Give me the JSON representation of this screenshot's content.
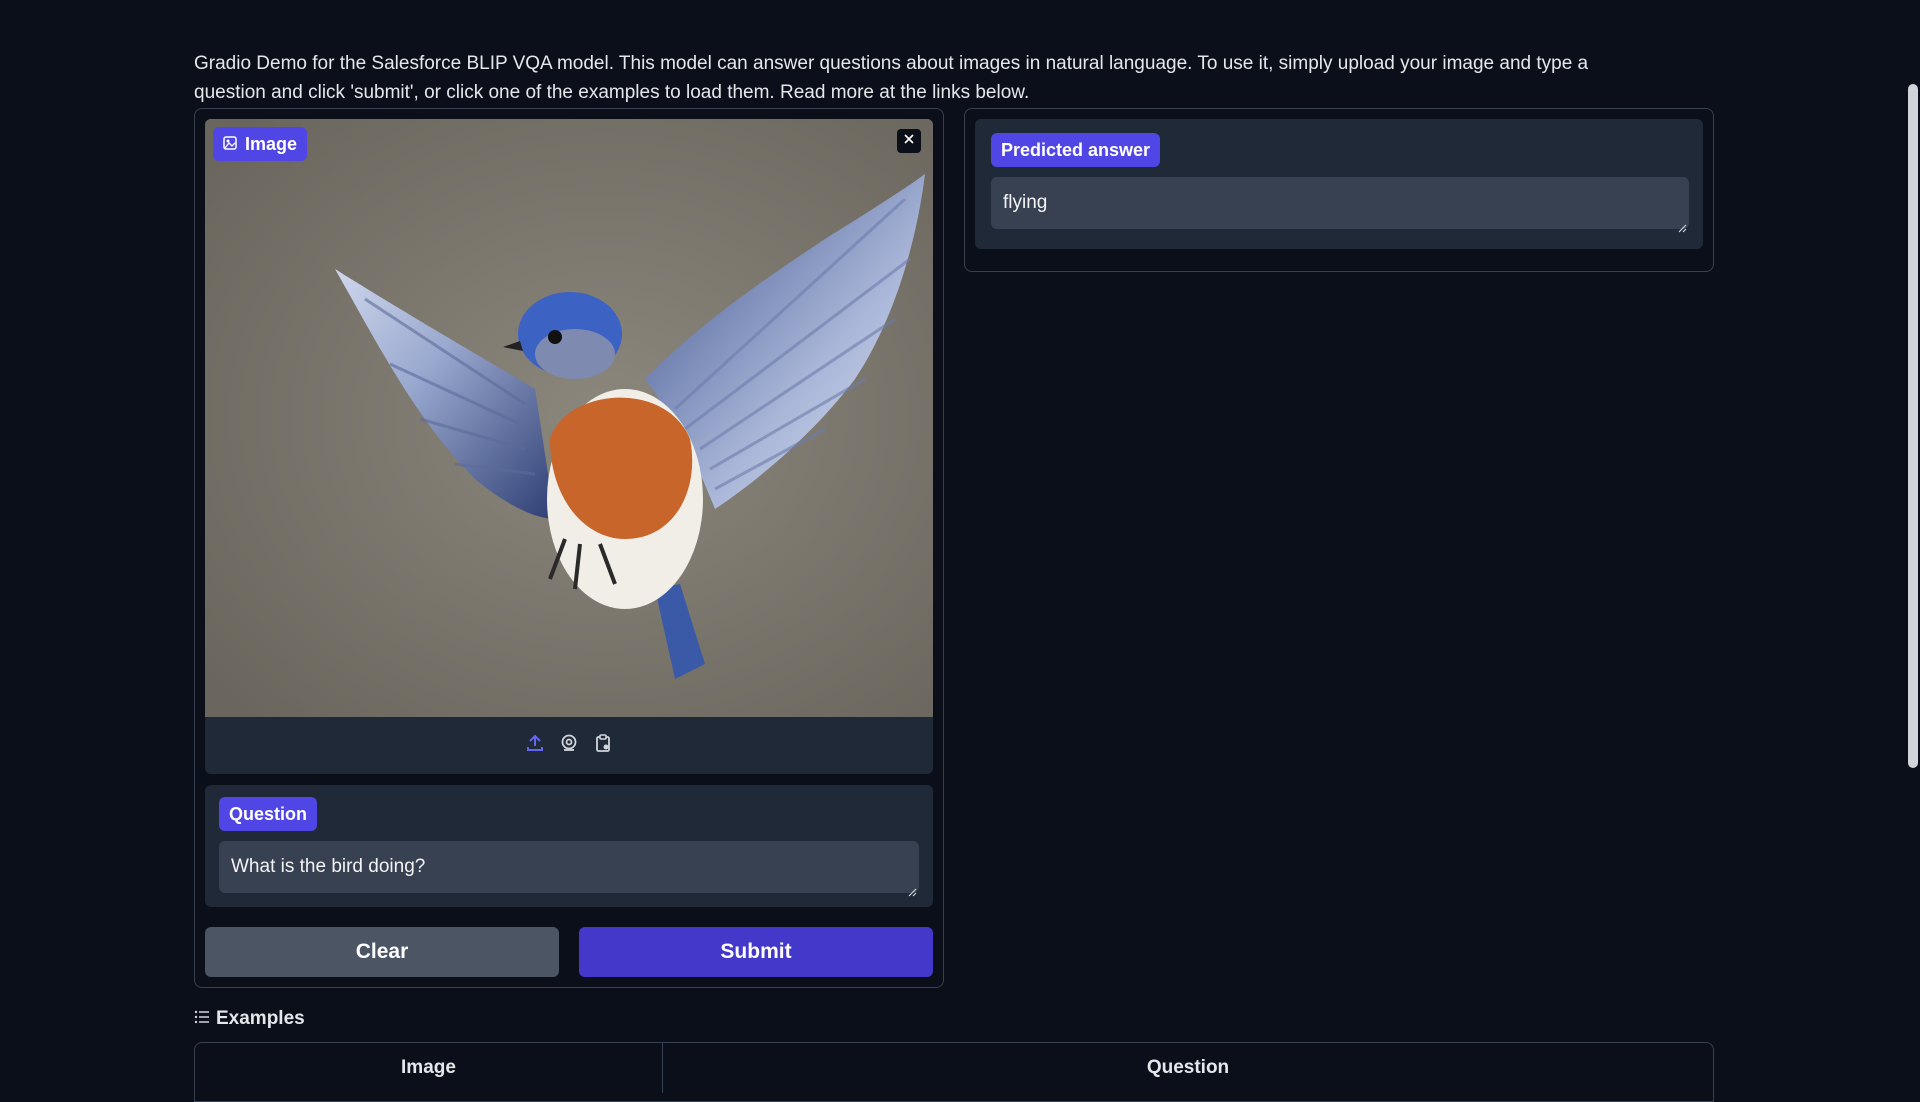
{
  "description": "Gradio Demo for the Salesforce BLIP VQA model. This model can answer questions about images in natural language. To use it, simply upload your image and type a question and click 'submit', or click one of the examples to load them. Read more at the links below.",
  "image_input": {
    "label": "Image",
    "label_icon": "image-icon",
    "close_icon": "close-icon",
    "toolbar": {
      "upload_icon": "upload-icon",
      "webcam_icon": "webcam-icon",
      "clipboard_icon": "clipboard-icon"
    }
  },
  "question": {
    "label": "Question",
    "value": "What is the bird doing?"
  },
  "buttons": {
    "clear_label": "Clear",
    "submit_label": "Submit"
  },
  "answer": {
    "label": "Predicted answer",
    "value": "flying"
  },
  "examples": {
    "title": "Examples",
    "icon": "list-icon",
    "columns": [
      "Image",
      "Question"
    ]
  },
  "colors": {
    "background": "#0b0f19",
    "panel": "#1f2937",
    "accent": "#4f46e5",
    "submit": "#4338ca",
    "clear": "#4b5563",
    "input": "#374151"
  }
}
